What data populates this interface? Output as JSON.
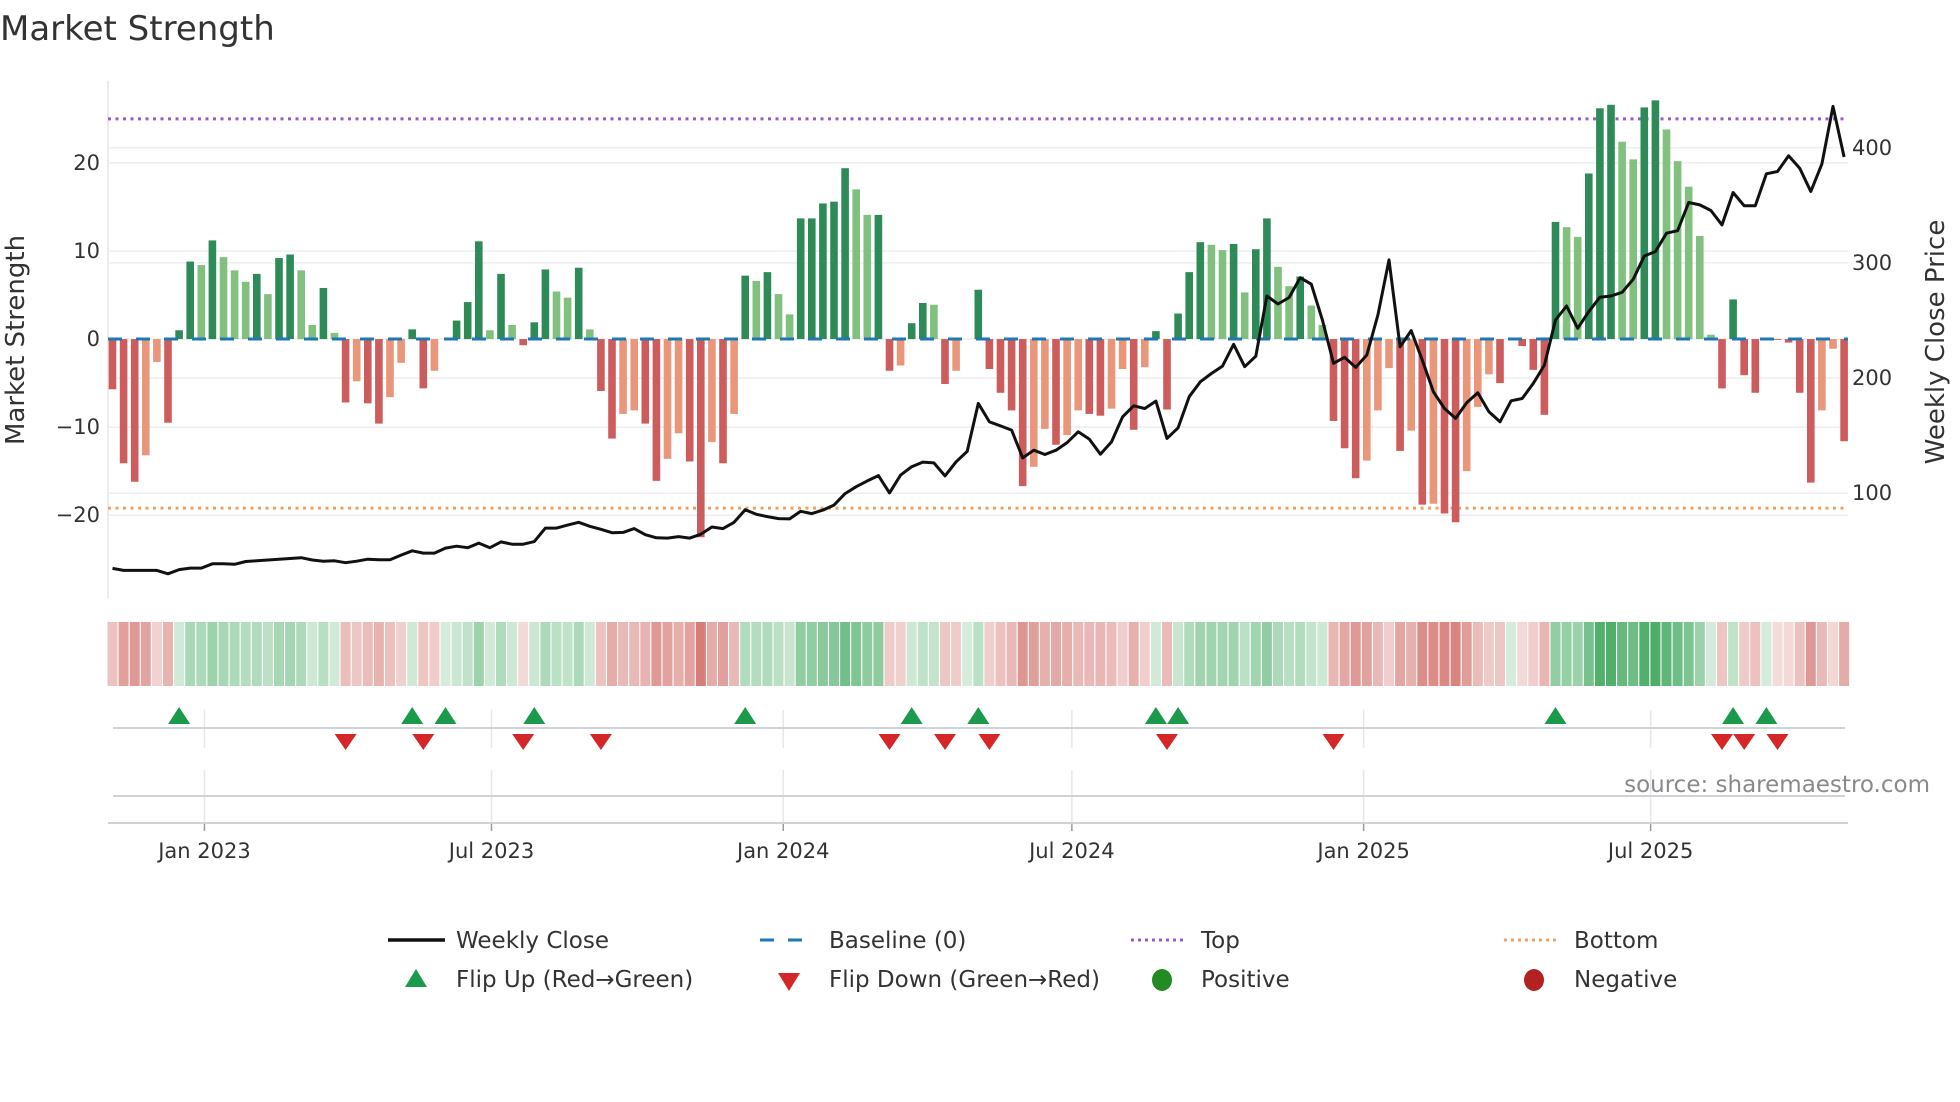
{
  "chart_data": {
    "type": "bar",
    "title": "Market Strength",
    "ylabel": "Market Strength",
    "y2label": "Weekly Close Price",
    "ylim": [
      -29.4,
      29.3
    ],
    "y2lim": [
      9,
      458
    ],
    "yticks": [
      20,
      10,
      0,
      -10,
      -20
    ],
    "ytick_labels": [
      "20",
      "10",
      "0",
      "−10",
      "−20"
    ],
    "y2ticks": [
      400,
      300,
      200,
      100
    ],
    "y2tick_labels": [
      "400",
      "300",
      "200",
      "100"
    ],
    "x_start_date": "2022-11-04",
    "x_interval_days": 7,
    "xticks": [
      {
        "date": "2023-01-01",
        "label": "Jan 2023"
      },
      {
        "date": "2023-07-01",
        "label": "Jul 2023"
      },
      {
        "date": "2024-01-01",
        "label": "Jan 2024"
      },
      {
        "date": "2024-07-01",
        "label": "Jul 2024"
      },
      {
        "date": "2025-01-01",
        "label": "Jan 2025"
      },
      {
        "date": "2025-07-01",
        "label": "Jul 2025"
      }
    ],
    "top_level": 25,
    "bottom_level": -19.2,
    "baseline": 0,
    "strength": [
      -5.7,
      -14.1,
      -16.2,
      -13.2,
      -2.6,
      -9.5,
      1.0,
      8.8,
      8.4,
      11.2,
      9.3,
      7.8,
      6.5,
      7.4,
      5.1,
      9.2,
      9.6,
      7.8,
      1.6,
      5.8,
      0.7,
      -7.2,
      -4.8,
      -7.3,
      -9.6,
      -6.6,
      -2.7,
      1.1,
      -5.6,
      -3.6,
      0,
      2.1,
      4.2,
      11.1,
      1.0,
      7.4,
      1.6,
      -0.7,
      1.9,
      7.9,
      5.4,
      4.7,
      8.1,
      1.1,
      -5.9,
      -11.3,
      -8.5,
      -8.1,
      -9.6,
      -16.1,
      -13.6,
      -10.7,
      -13.9,
      -22.5,
      -11.7,
      -14.1,
      -8.5,
      7.2,
      6.6,
      7.6,
      5.1,
      2.8,
      13.7,
      13.7,
      15.4,
      15.6,
      19.4,
      17.0,
      14.1,
      14.1,
      -3.6,
      -3.0,
      1.8,
      4.1,
      3.9,
      -5.1,
      -3.6,
      0,
      5.6,
      -3.4,
      -6.1,
      -8.1,
      -16.7,
      -14.5,
      -10.2,
      -12.0,
      -10.9,
      -8.1,
      -8.5,
      -8.7,
      -7.9,
      -3.4,
      -10.3,
      -3.2,
      0.9,
      -8.0,
      2.9,
      7.6,
      11.0,
      10.7,
      10.1,
      10.8,
      5.3,
      10.2,
      13.7,
      8.2,
      6.0,
      7.1,
      3.8,
      1.6,
      -9.3,
      -12.4,
      -15.8,
      -13.8,
      -8.1,
      -3.3,
      -12.7,
      -10.4,
      -18.8,
      -18.7,
      -19.8,
      -20.8,
      -15.0,
      -7.7,
      -4.0,
      -5.0,
      0,
      -0.8,
      -3.5,
      -8.6,
      13.3,
      12.7,
      11.6,
      18.8,
      26.2,
      26.6,
      22.4,
      20.4,
      26.3,
      27.1,
      23.8,
      20.2,
      17.3,
      11.7,
      0.5,
      -5.6,
      4.5,
      -4.1,
      -6.1,
      0.1,
      -0.1,
      -0.4,
      -6.1,
      -16.3,
      -8.1,
      -1.1,
      -11.6
    ],
    "weekly_close": [
      34.7,
      33,
      33,
      33,
      33,
      30,
      33.7,
      35,
      35,
      38.7,
      38.7,
      38.3,
      40.7,
      41.3,
      42,
      42.7,
      43.3,
      44,
      42,
      41,
      41.3,
      39.7,
      41,
      42.7,
      42.3,
      42.3,
      46.3,
      50,
      48,
      48,
      52.3,
      54,
      52.7,
      56.7,
      52.7,
      57.7,
      55.7,
      55.7,
      58,
      69.7,
      69.7,
      72.3,
      74.7,
      71.3,
      68.7,
      65.7,
      66,
      69.3,
      64,
      61.3,
      61,
      62.3,
      61,
      64.3,
      70.7,
      69.3,
      74.7,
      85.7,
      81.7,
      79.7,
      78,
      77.7,
      84.3,
      82.3,
      85.3,
      89.7,
      99.7,
      105.7,
      110.7,
      115.3,
      100.3,
      115.7,
      123,
      127,
      126.3,
      115,
      127.3,
      136.3,
      178,
      162,
      158.5,
      154.8,
      130.7,
      137.4,
      133.6,
      137.4,
      144,
      153.3,
      147,
      133.9,
      144.6,
      166.4,
      175.9,
      173.6,
      180,
      147.6,
      156.8,
      183.8,
      196.8,
      204,
      210.4,
      229.3,
      209.9,
      219,
      271.3,
      264.3,
      270,
      287.2,
      281.5,
      250.4,
      212.8,
      218,
      209.3,
      220,
      254.8,
      302.6,
      227.2,
      241.2,
      215.6,
      188.1,
      173.6,
      165,
      178.5,
      187.2,
      170.7,
      162,
      180.3,
      182.3,
      195.4,
      211.3,
      250.4,
      262.6,
      243.2,
      257.7,
      270.2,
      271.3,
      274.5,
      285.8,
      306,
      309.8,
      325.8,
      328,
      352.5,
      350.4,
      345.5,
      333,
      361.2,
      349.6,
      349.6,
      377.4,
      379.4,
      393,
      382.3,
      362,
      386,
      435.9,
      392
    ],
    "flip_up_week_index": [
      6,
      27,
      30,
      38,
      57,
      72,
      78,
      94,
      96,
      130,
      146,
      149
    ],
    "flip_down_week_index": [
      21,
      28,
      37,
      44,
      70,
      75,
      79,
      95,
      110,
      145,
      147,
      150
    ],
    "legend": {
      "weekly_close": "Weekly Close",
      "baseline": "Baseline (0)",
      "top": "Top",
      "bottom": "Bottom",
      "flip_up": "Flip Up (Red→Green)",
      "flip_down": "Flip Down (Green→Red)",
      "positive": "Positive",
      "negative": "Negative"
    },
    "legend_placement": "bottom",
    "grid": true,
    "source": "source: sharemaestro.com"
  },
  "colors": {
    "pos_strong": "#2e8b57",
    "pos_weak": "#81c07f",
    "neg_strong": "#cd5c5c",
    "neg_weak": "#e9967a",
    "line": "#111111",
    "baseline": "#1f77b4",
    "top": "#9b59d0",
    "bottom": "#f0a060",
    "flip_up": "#1a9a4a",
    "flip_down": "#d62728",
    "positive": "#228b22",
    "negative": "#b22222"
  }
}
